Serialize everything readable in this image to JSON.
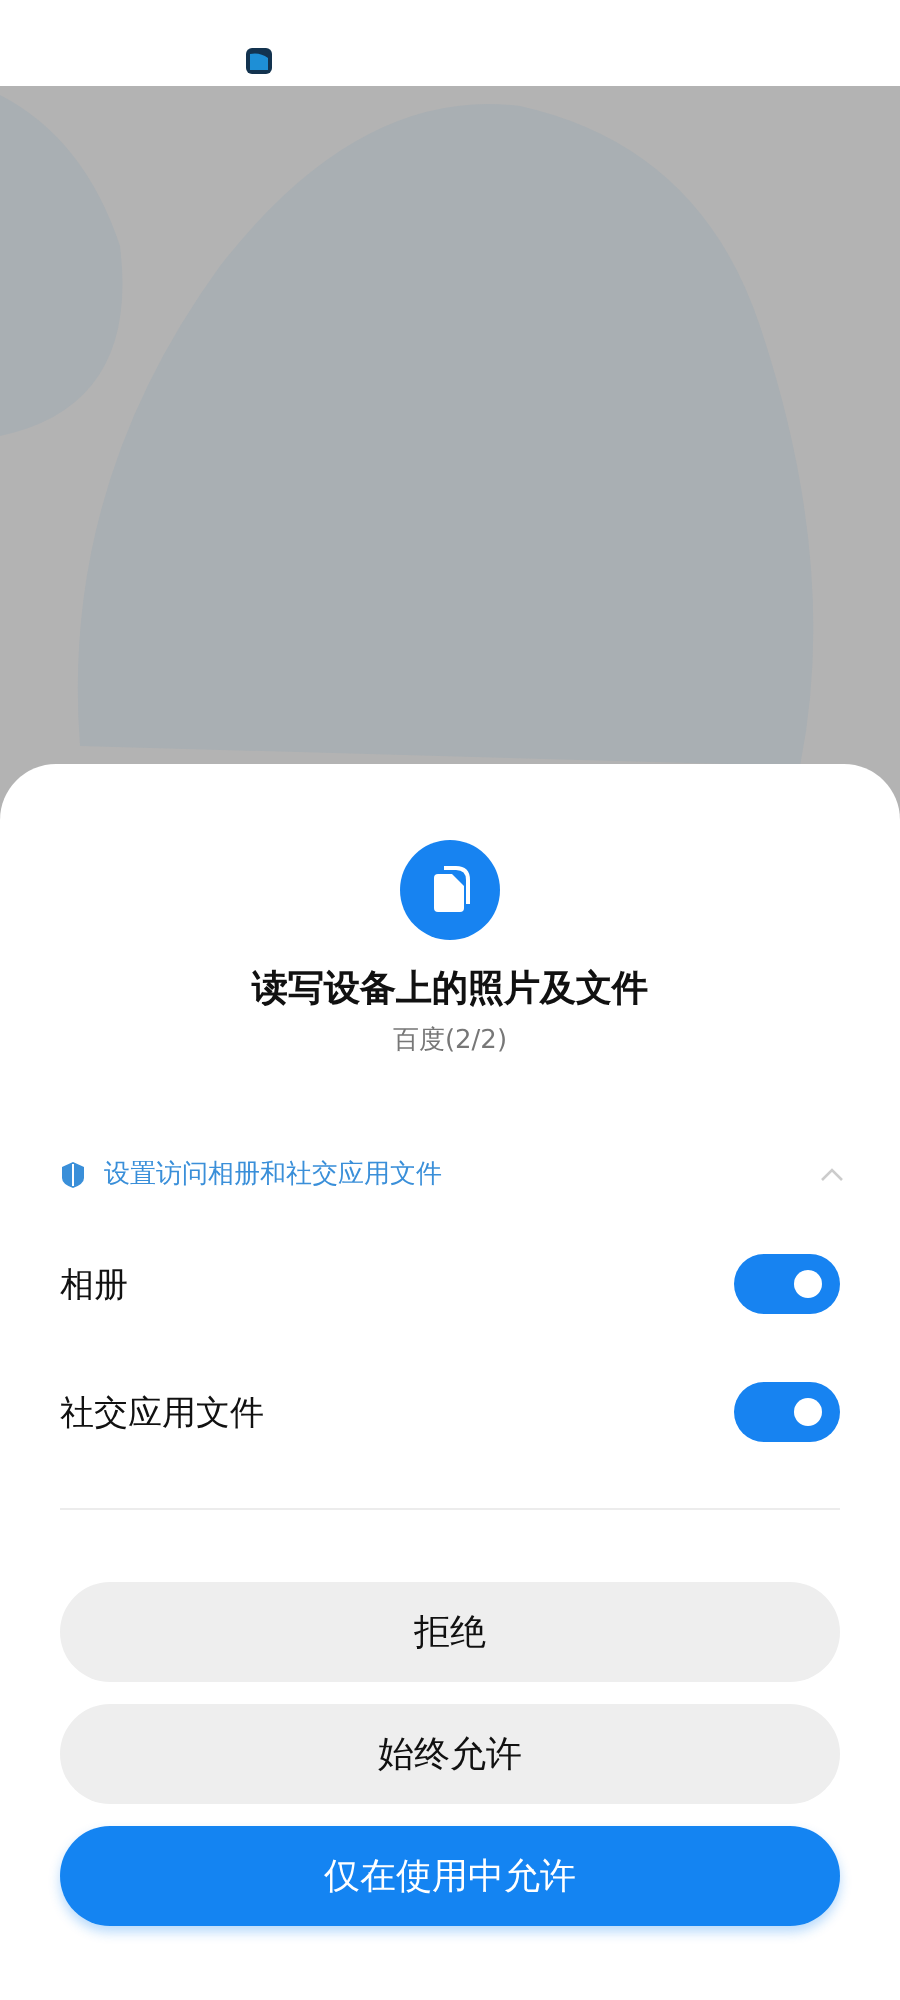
{
  "dialog": {
    "title": "读写设备上的照片及文件",
    "subtitle": "百度(2/2)",
    "section": {
      "label": "设置访问相册和社交应用文件",
      "expanded": true
    },
    "permissions": [
      {
        "label": "相册",
        "on": true
      },
      {
        "label": "社交应用文件",
        "on": true
      }
    ],
    "buttons": [
      {
        "label": "拒绝",
        "kind": "secondary"
      },
      {
        "label": "始终允许",
        "kind": "secondary"
      },
      {
        "label": "仅在使用中允许",
        "kind": "primary"
      }
    ]
  }
}
